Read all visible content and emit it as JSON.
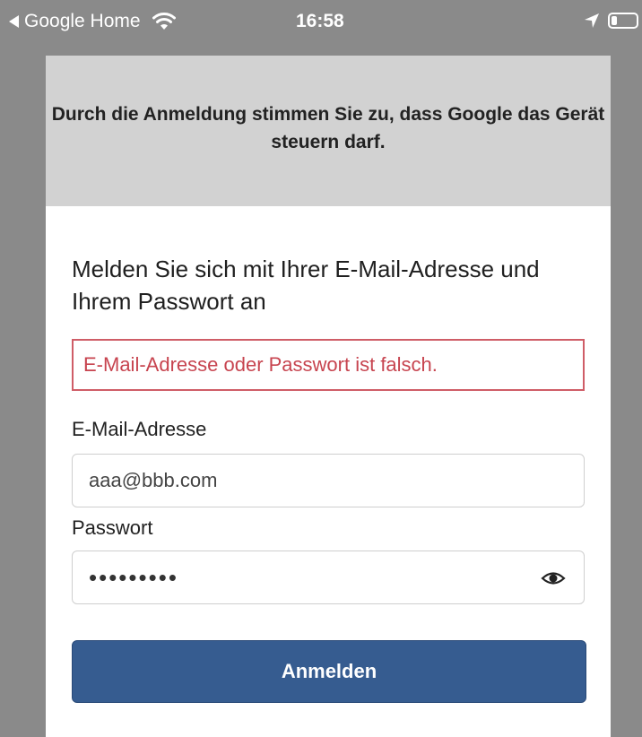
{
  "status_bar": {
    "back_app": "Google Home",
    "time": "16:58",
    "icons": [
      "back-arrow-icon",
      "wifi-icon",
      "location-icon",
      "battery-icon"
    ]
  },
  "consent": {
    "text": "Durch die Anmeldung stimmen Sie zu, dass Google das Gerät steuern darf."
  },
  "login": {
    "heading": "Melden Sie sich mit Ihrer E-Mail-Adresse und Ihrem Passwort an",
    "error": "E-Mail-Adresse oder Passwort ist falsch.",
    "email_label": "E-Mail-Adresse",
    "email_value": "aaa@bbb.com",
    "password_label": "Passwort",
    "password_value": "•••••••••",
    "submit_label": "Anmelden"
  },
  "colors": {
    "header_bg": "#d2d2d2",
    "error": "#c7444f",
    "button": "#365c90"
  }
}
